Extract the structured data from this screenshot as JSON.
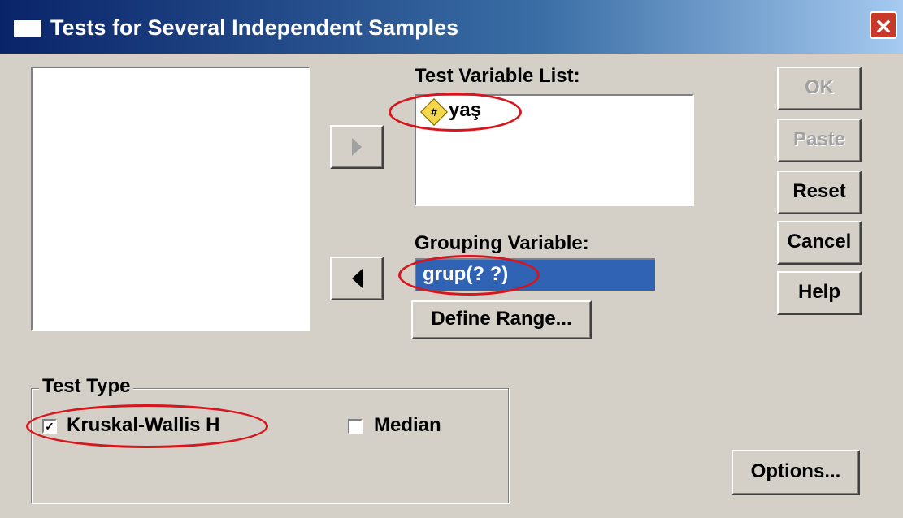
{
  "window": {
    "title": "Tests for Several Independent Samples",
    "close_glyph": "✕"
  },
  "test_variable_list": {
    "label": "Test Variable List:",
    "items": [
      {
        "name": "yaş",
        "icon": "scale-variable-icon",
        "icon_glyph": "#"
      }
    ]
  },
  "grouping_variable": {
    "label": "Grouping Variable:",
    "value": "grup(? ?)"
  },
  "buttons": {
    "ok": "OK",
    "paste": "Paste",
    "reset": "Reset",
    "cancel": "Cancel",
    "help": "Help",
    "define_range": "Define Range...",
    "options": "Options..."
  },
  "test_type": {
    "label": "Test Type",
    "options": [
      {
        "label": "Kruskal-Wallis H",
        "checked": true,
        "check_glyph": "✓"
      },
      {
        "label": "Median",
        "checked": false
      }
    ]
  },
  "colors": {
    "highlight": "#3163b5",
    "annotation": "#d8141c",
    "face": "#d4d0c8"
  }
}
